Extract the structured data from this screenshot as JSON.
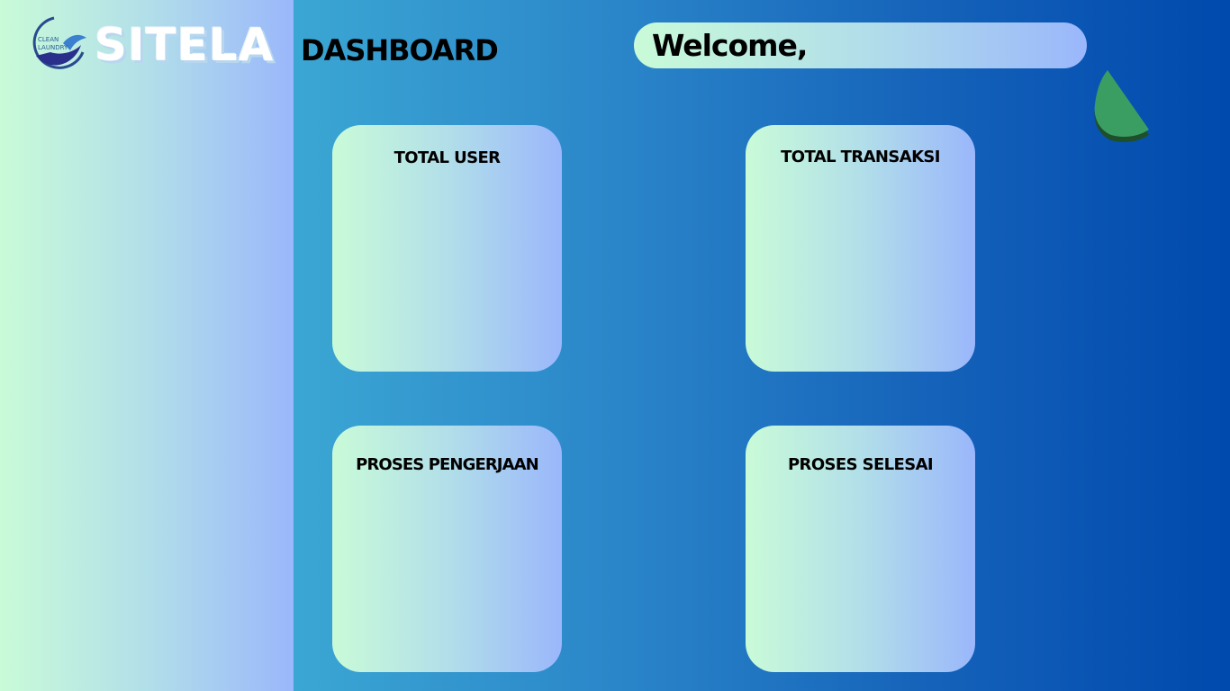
{
  "brand": {
    "logo_text_top": "CLEAN",
    "logo_text_bottom": "LAUNDRY",
    "name": "SITELA"
  },
  "header": {
    "title": "DASHBOARD",
    "welcome": "Welcome,"
  },
  "cards": [
    {
      "title": "TOTAL USER"
    },
    {
      "title": "TOTAL TRANSAKSI"
    },
    {
      "title": "PROSES PENGERJAAN"
    },
    {
      "title": "PROSES SELESAI"
    }
  ],
  "colors": {
    "card_gradient_start": "#c9fbd8",
    "card_gradient_end": "#9ab7fb",
    "background_start": "#47bdd9",
    "background_end": "#0049ad",
    "pie_slice": "#3a9e62"
  },
  "icons": {
    "logo": "clean-laundry-logo-icon",
    "chart": "pie-chart-icon"
  }
}
